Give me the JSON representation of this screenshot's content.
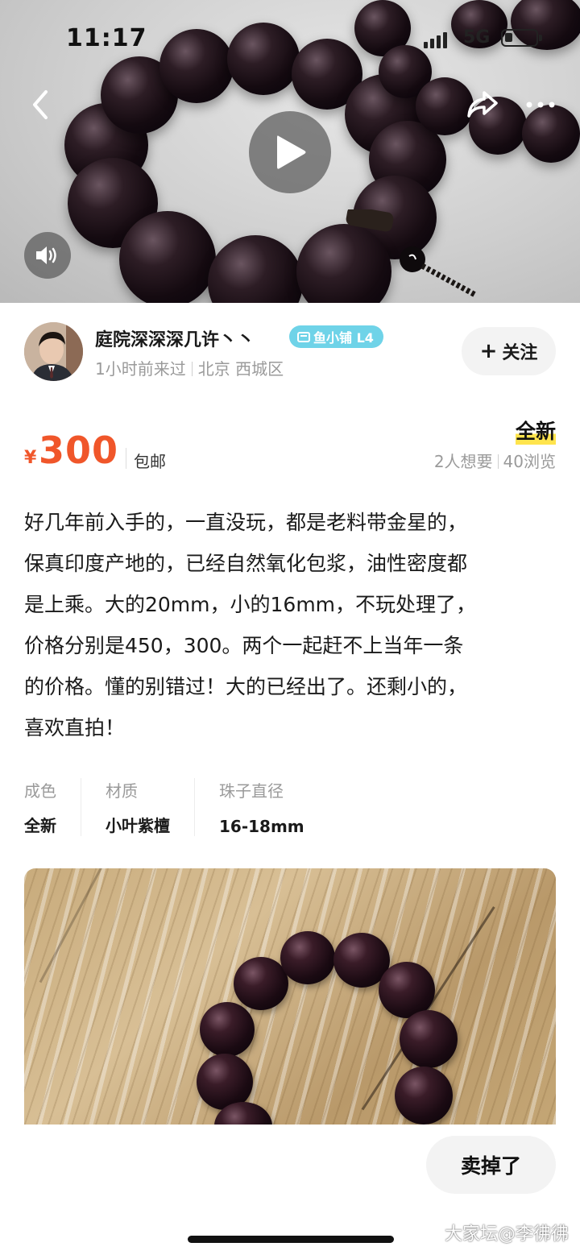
{
  "status_bar": {
    "time": "11:17",
    "network": "5G"
  },
  "seller": {
    "name": "庭院深深深几许丶丶",
    "badge": "鱼小铺 L4",
    "last_seen": "1小时前来过",
    "location": "北京 西城区",
    "follow_label": "关注"
  },
  "item": {
    "currency": "¥",
    "price": "300",
    "shipping": "包邮",
    "condition": "全新",
    "wants": "2人想要",
    "views": "40浏览",
    "description": "好几年前入手的，一直没玩，都是老料带金星的，\n保真印度产地的，已经自然氧化包浆，油性密度都\n是上乘。大的20mm，小的16mm，不玩处理了，\n价格分别是450，300。两个一起赶不上当年一条\n的价格。懂的别错过！大的已经出了。还剩小的，\n喜欢直拍！",
    "attributes": [
      {
        "key": "成色",
        "value": "全新"
      },
      {
        "key": "材质",
        "value": "小叶紫檀"
      },
      {
        "key": "珠子直径",
        "value": "16-18mm"
      }
    ]
  },
  "actions": {
    "sold_label": "卖掉了"
  },
  "watermark": "大家坛@李彿彿",
  "colors": {
    "price": "#f0562a",
    "badge": "#6fd3e8",
    "condition_highlight": "#ffe44d"
  }
}
